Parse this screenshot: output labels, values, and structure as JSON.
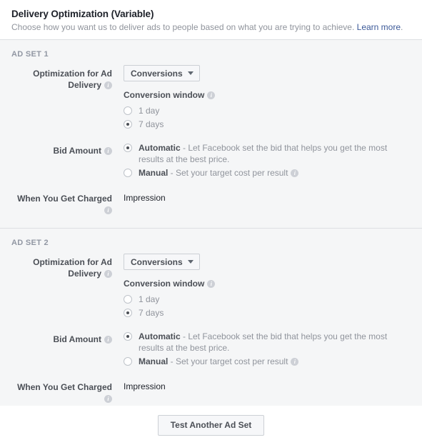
{
  "header": {
    "title": "Delivery Optimization (Variable)",
    "description_before_link": "Choose how you want us to deliver ads to people based on what you are trying to achieve. ",
    "link_label": "Learn more",
    "description_after_link": "."
  },
  "labels": {
    "optimization": "Optimization for Ad Delivery",
    "conversion_window": "Conversion window",
    "bid_amount": "Bid Amount",
    "when_charged": "When You Get Charged",
    "info_glyph": "i"
  },
  "options": {
    "optimization_selected": "Conversions",
    "optimization_choices": [
      "Conversions"
    ],
    "window_1day": "1 day",
    "window_7days": "7 days",
    "bid_automatic_strong": "Automatic",
    "bid_automatic_rest": " - Let Facebook set the bid that helps you get the most results at the best price.",
    "bid_manual_strong": "Manual",
    "bid_manual_rest": " - Set your target cost per result",
    "charged_value": "Impression"
  },
  "adsets": [
    {
      "name": "AD SET 1",
      "window_selected": "7 days",
      "bid_selected": "Automatic",
      "optimization_value": "Conversions",
      "charged_value": "Impression"
    },
    {
      "name": "AD SET 2",
      "window_selected": "7 days",
      "bid_selected": "Automatic",
      "optimization_value": "Conversions",
      "charged_value": "Impression"
    }
  ],
  "footer": {
    "test_another_label": "Test Another Ad Set"
  },
  "colors": {
    "link": "#3b5998",
    "body_bg": "#f5f6f7",
    "border": "#dddfe2",
    "label_text": "#4b4f56",
    "muted_text": "#90949c"
  }
}
